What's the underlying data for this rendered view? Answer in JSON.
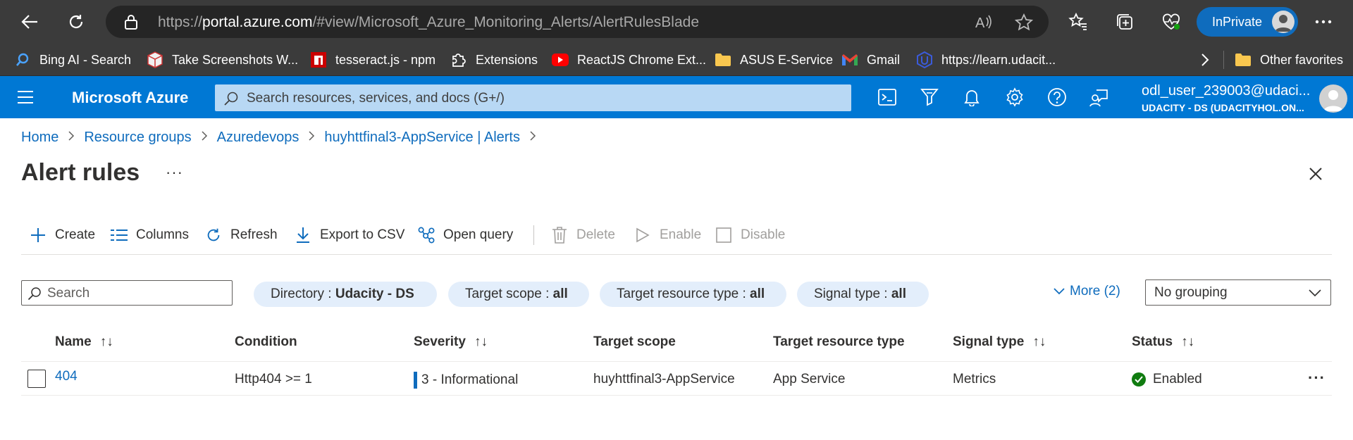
{
  "browser": {
    "url_prefix": "https://",
    "url_host": "portal.azure.com",
    "url_path": "/#view/Microsoft_Azure_Monitoring_Alerts/AlertRulesBlade",
    "inprivate_label": "InPrivate"
  },
  "favorites": [
    {
      "label": "Bing AI - Search",
      "icon": "search-icon"
    },
    {
      "label": "Take Screenshots W...",
      "icon": "screenshot-icon"
    },
    {
      "label": "tesseract.js - npm",
      "icon": "npm-icon"
    },
    {
      "label": "Extensions",
      "icon": "puzzle-icon"
    },
    {
      "label": "ReactJS Chrome Ext...",
      "icon": "youtube-icon"
    },
    {
      "label": "ASUS E-Service",
      "icon": "folder-icon"
    },
    {
      "label": "Gmail",
      "icon": "gmail-icon"
    },
    {
      "label": "https://learn.udacit...",
      "icon": "udacity-icon"
    }
  ],
  "other_favorites": "Other favorites",
  "azure": {
    "brand": "Microsoft Azure",
    "search_placeholder": "Search resources, services, and docs (G+/)",
    "account_name": "odl_user_239003@udaci...",
    "account_directory": "UDACITY - DS (UDACITYHOL.ON..."
  },
  "breadcrumb": [
    "Home",
    "Resource groups",
    "Azuredevops",
    "huyhttfinal3-AppService | Alerts"
  ],
  "page": {
    "title": "Alert rules",
    "more": "···"
  },
  "toolbar": {
    "create": "Create",
    "columns": "Columns",
    "refresh": "Refresh",
    "export": "Export to CSV",
    "open_query": "Open query",
    "delete": "Delete",
    "enable": "Enable",
    "disable": "Disable"
  },
  "filters": {
    "search_placeholder": "Search",
    "pills": [
      {
        "key": "Directory : ",
        "value": "Udacity - DS"
      },
      {
        "key": "Target scope : ",
        "value": "all"
      },
      {
        "key": "Target resource type : ",
        "value": "all"
      },
      {
        "key": "Signal type : ",
        "value": "all"
      }
    ],
    "more": "More (2)",
    "grouping": "No grouping"
  },
  "table": {
    "columns": [
      "Name",
      "Condition",
      "Severity",
      "Target scope",
      "Target resource type",
      "Signal type",
      "Status"
    ],
    "sort_glyph": "↑↓",
    "rows": [
      {
        "name": "404",
        "condition": "Http404 >= 1",
        "severity": "3 - Informational",
        "target_scope": "huyhttfinal3-AppService",
        "target_resource_type": "App Service",
        "signal_type": "Metrics",
        "status": "Enabled"
      }
    ]
  },
  "colors": {
    "azure_blue": "#0078d4",
    "link": "#0f6cbd",
    "enabled_green": "#107c10",
    "browser_chrome": "#3b3b3b"
  }
}
